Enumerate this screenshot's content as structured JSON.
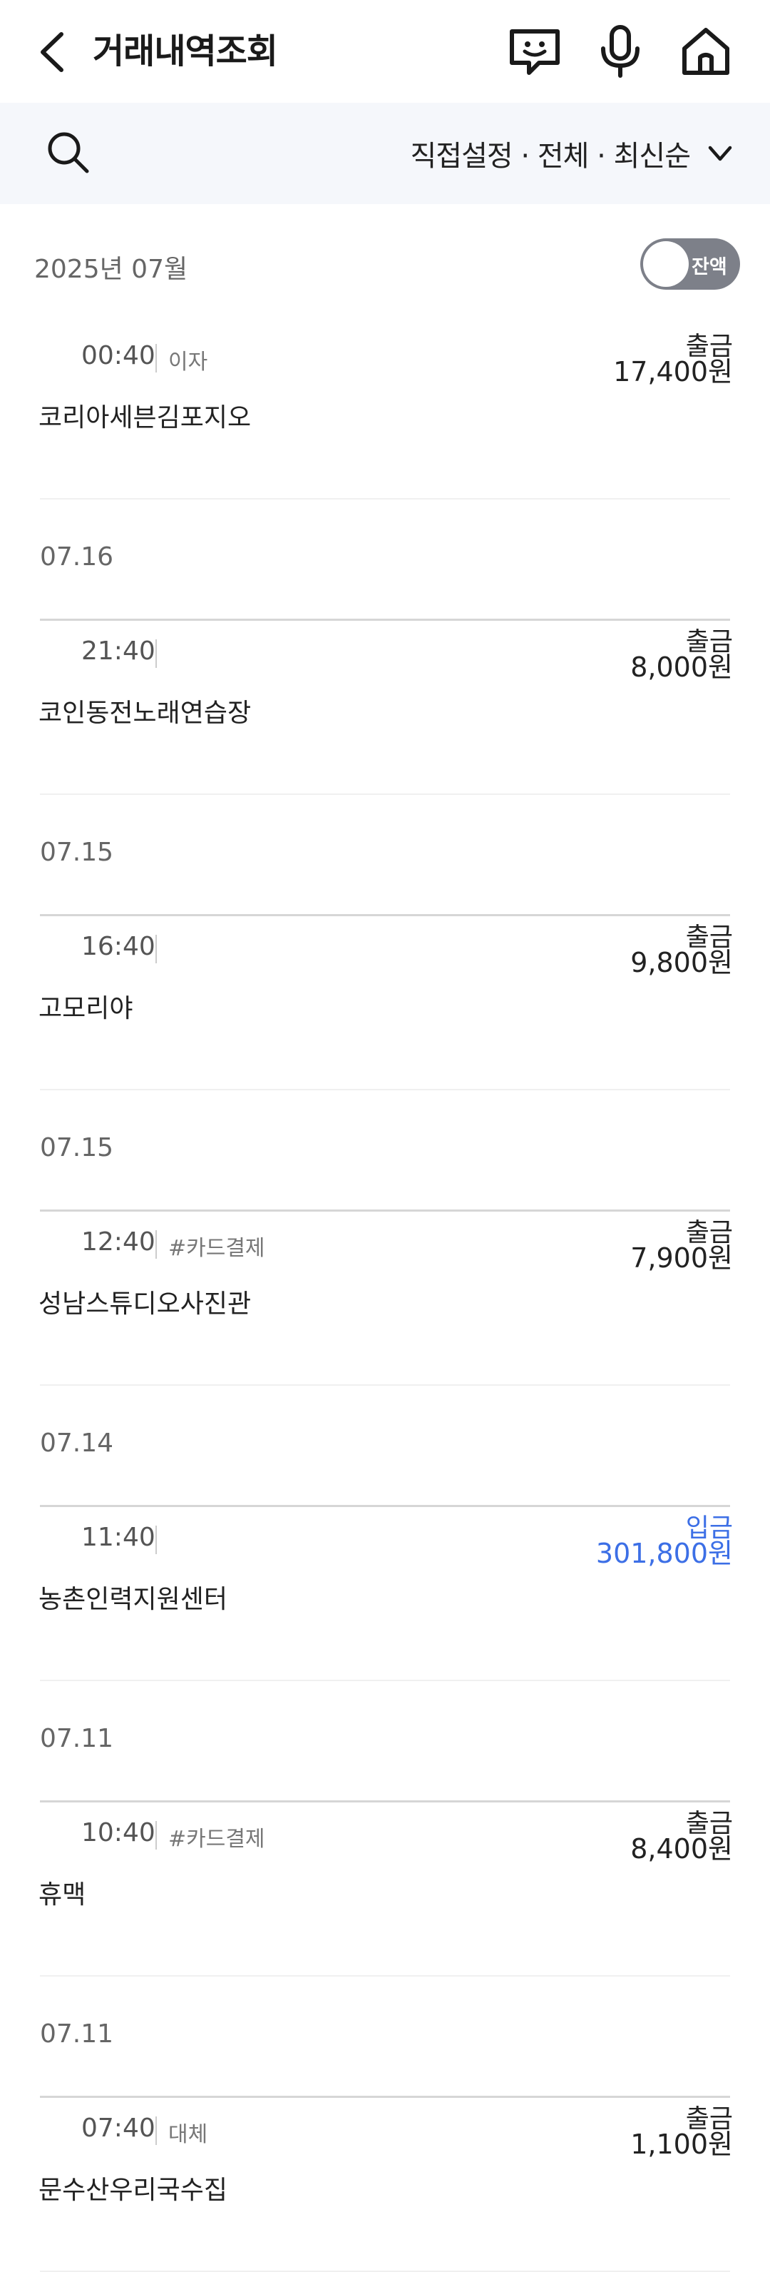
{
  "header": {
    "title": "거래내역조회",
    "icons": [
      "back-icon",
      "chatbot-icon",
      "microphone-icon",
      "home-icon"
    ]
  },
  "filter": {
    "label": "직접설정 · 전체 · 최신순"
  },
  "month": {
    "label": "2025년 07월",
    "toggle_label": "잔액",
    "toggle_on": false
  },
  "colors": {
    "deposit": "#3c6fe6",
    "toggle_bg": "#7d8089",
    "filter_bg": "#f5f7fb"
  },
  "groups": [
    {
      "date": "",
      "transactions": [
        {
          "time": "00:40",
          "tag": "이자",
          "name": "코리아세븐김포지오",
          "type": "출금",
          "amount": "17,400원"
        }
      ]
    },
    {
      "date": "07.16",
      "transactions": [
        {
          "time": "21:40",
          "tag": "",
          "name": "코인동전노래연습장",
          "type": "출금",
          "amount": "8,000원"
        }
      ]
    },
    {
      "date": "07.15",
      "transactions": [
        {
          "time": "16:40",
          "tag": "",
          "name": "고모리야",
          "type": "출금",
          "amount": "9,800원"
        }
      ]
    },
    {
      "date": "07.15",
      "transactions": [
        {
          "time": "12:40",
          "tag": "#카드결제",
          "name": "성남스튜디오사진관",
          "type": "출금",
          "amount": "7,900원"
        }
      ]
    },
    {
      "date": "07.14",
      "transactions": [
        {
          "time": "11:40",
          "tag": "",
          "name": "농촌인력지원센터",
          "type": "입금",
          "amount": "301,800원"
        }
      ]
    },
    {
      "date": "07.11",
      "transactions": [
        {
          "time": "10:40",
          "tag": "#카드결제",
          "name": "휴맥",
          "type": "출금",
          "amount": "8,400원"
        }
      ]
    },
    {
      "date": "07.11",
      "transactions": [
        {
          "time": "07:40",
          "tag": "대체",
          "name": "문수산우리국수집",
          "type": "출금",
          "amount": "1,100원"
        }
      ]
    }
  ]
}
